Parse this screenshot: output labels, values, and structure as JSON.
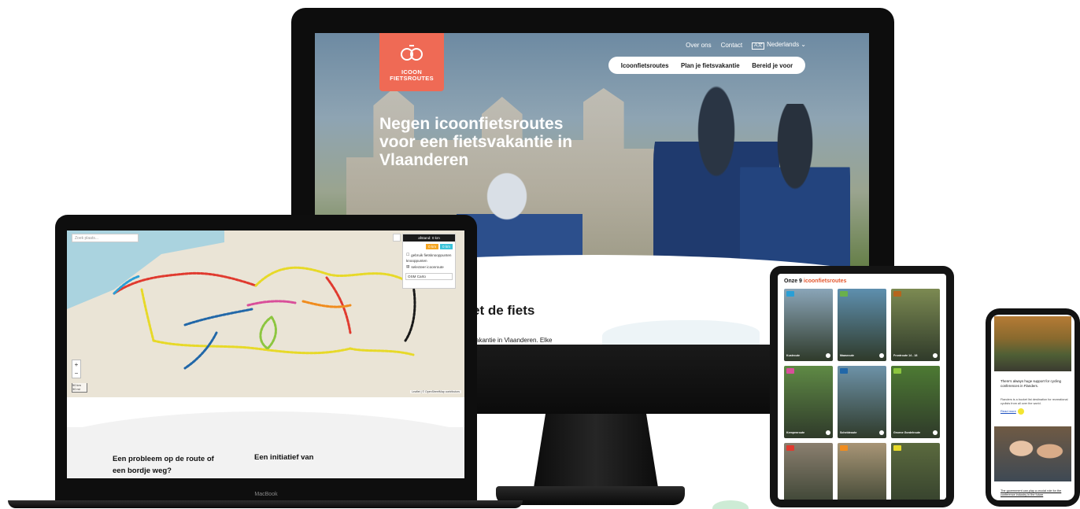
{
  "imac": {
    "logo": {
      "line1": "ICOON",
      "line2": "FIETSROUTES"
    },
    "topnav": {
      "about": "Over ons",
      "contact": "Contact",
      "language": "Nederlands ⌄"
    },
    "mainnav": [
      "Icoonfietsroutes",
      "Plan je fietsvakantie",
      "Bereid je voor"
    ],
    "hero_title": "Negen icoonfietsroutes voor een fietsvakantie in Vlaanderen",
    "section_heading": "et de fiets",
    "section_text": "vakantie in Vlaanderen. Elke"
  },
  "laptop": {
    "map": {
      "search_placeholder": "Zoek plaats...",
      "distance": "afstand: 0 km",
      "btn_one": "0 km",
      "btn_two": "0 km",
      "option_nodes": "gebruik fietsknooppunten",
      "option_routes": "knooppunten",
      "option_select": "selecteer icoonroute",
      "basemap": "OSM Carto",
      "zoom_in": "+",
      "zoom_out": "−",
      "scale_top": "50 km",
      "scale_bottom": "30 mi",
      "attribution": "Leaflet | © OpenStreetMap contributors"
    },
    "footer_question": "Een probleem op de route of een bordje weg?",
    "footer_initiative": "Een initiatief van",
    "brand": "MacBook"
  },
  "tablet": {
    "title_prefix": "Onze 9 ",
    "title_accent": "icoonfietsroutes",
    "cards": [
      {
        "label": "Kustroute",
        "badge": "#2a9fd6",
        "bg": "#8aa5b8"
      },
      {
        "label": "Maasroute",
        "badge": "#6ab04c",
        "bg": "#5e8fae"
      },
      {
        "label": "Frontroute 14 - 18",
        "badge": "#b5651d",
        "bg": "#7c8a52"
      },
      {
        "label": "Kempenroute",
        "badge": "#d94f9a",
        "bg": "#5f8a45"
      },
      {
        "label": "Scheldeoute",
        "badge": "#2167a8",
        "bg": "#6d92a8"
      },
      {
        "label": "Groene Gordelroute",
        "badge": "#8cc63f",
        "bg": "#4d7a33"
      },
      {
        "label": "",
        "badge": "#e03a2f",
        "bg": "#8b7f6f"
      },
      {
        "label": "",
        "badge": "#f08c1e",
        "bg": "#a89576"
      },
      {
        "label": "",
        "badge": "#e7d928",
        "bg": "#5b6a3e"
      }
    ]
  },
  "phone": {
    "text1": "There's always huge support for cycling conferences in Flanders.",
    "text2": "Flanders is a bucket list destination for recreational cyclists from all over the world.",
    "link": "Read more",
    "text3": "The government can play a crucial role for the conference industry in the future"
  }
}
